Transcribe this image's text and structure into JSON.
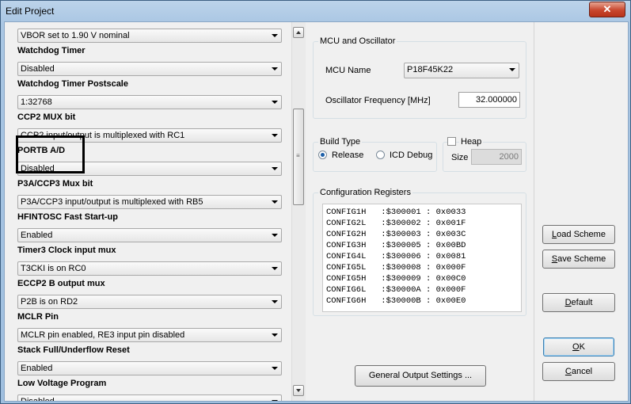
{
  "window": {
    "title": "Edit Project",
    "close_label": "✕"
  },
  "settings": [
    {
      "label": "",
      "value": "VBOR set to 1.90 V nominal"
    },
    {
      "label": "Watchdog Timer",
      "value": "Disabled"
    },
    {
      "label": "Watchdog Timer Postscale",
      "value": "1:32768"
    },
    {
      "label": "CCP2 MUX bit",
      "value": "CCP2 input/output is multiplexed with RC1"
    },
    {
      "label": "PORTB A/D",
      "value": "Disabled"
    },
    {
      "label": "P3A/CCP3 Mux bit",
      "value": "P3A/CCP3 input/output is multiplexed with RB5"
    },
    {
      "label": "HFINTOSC Fast Start-up",
      "value": "Enabled"
    },
    {
      "label": "Timer3 Clock input mux",
      "value": "T3CKI is on RC0"
    },
    {
      "label": "ECCP2 B output mux",
      "value": "P2B is on RD2"
    },
    {
      "label": "MCLR Pin",
      "value": "MCLR pin enabled, RE3 input pin disabled"
    },
    {
      "label": "Stack Full/Underflow Reset",
      "value": "Enabled"
    },
    {
      "label": "Low Voltage Program",
      "value": "Disabled"
    }
  ],
  "mcu": {
    "group_title": "MCU and Oscillator",
    "name_label": "MCU Name",
    "name_value": "P18F45K22",
    "freq_label": "Oscillator Frequency [MHz]",
    "freq_value": "32.000000"
  },
  "build": {
    "group_title": "Build Type",
    "release_label": "Release",
    "icd_label": "ICD Debug",
    "selected": "Release"
  },
  "heap": {
    "label": "Heap",
    "size_label": "Size",
    "size_value": "2000",
    "checked": false
  },
  "config": {
    "group_title": "Configuration Registers",
    "lines": [
      "CONFIG1H   :$300001 : 0x0033",
      "CONFIG2L   :$300002 : 0x001F",
      "CONFIG2H   :$300003 : 0x003C",
      "CONFIG3H   :$300005 : 0x00BD",
      "CONFIG4L   :$300006 : 0x0081",
      "CONFIG5L   :$300008 : 0x000F",
      "CONFIG5H   :$300009 : 0x00C0",
      "CONFIG6L   :$30000A : 0x000F",
      "CONFIG6H   :$30000B : 0x00E0"
    ]
  },
  "buttons": {
    "general_output": "General Output Settings ...",
    "load_scheme_u": "L",
    "load_scheme_rest": "oad Scheme",
    "save_scheme_u": "S",
    "save_scheme_rest": "ave Scheme",
    "default_u": "D",
    "default_rest": "efault",
    "ok_u": "O",
    "ok_rest": "K",
    "cancel_u": "C",
    "cancel_rest": "ancel"
  }
}
